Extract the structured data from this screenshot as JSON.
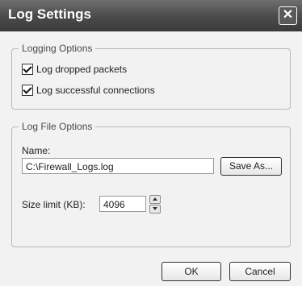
{
  "window": {
    "title": "Log Settings",
    "close_glyph": "✕"
  },
  "logging_options": {
    "legend": "Logging Options",
    "items": [
      {
        "label": "Log dropped packets",
        "checked": true
      },
      {
        "label": "Log successful connections",
        "checked": true
      }
    ]
  },
  "log_file_options": {
    "legend": "Log File Options",
    "name_label": "Name:",
    "name_value": "C:\\Firewall_Logs.log",
    "save_as_label": "Save As...",
    "size_label": "Size limit (KB):",
    "size_value": "4096"
  },
  "footer": {
    "ok_label": "OK",
    "cancel_label": "Cancel"
  }
}
